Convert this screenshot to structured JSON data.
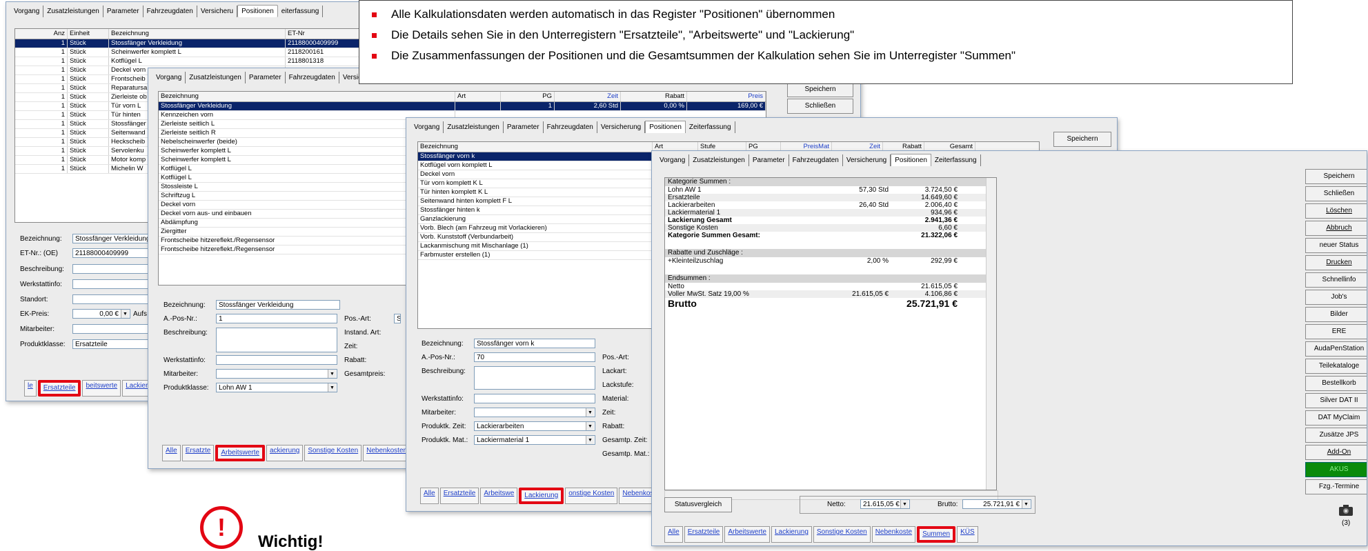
{
  "info_box": {
    "bullets": [
      "Alle Kalkulationsdaten werden automatisch in das Register \"Positionen\" übernommen",
      "Die Details sehen Sie in den Unterregistern \"Ersatzteile\", \"Arbeitswerte\" und \"Lackierung\"",
      "Die Zusammenfassungen der Positionen und die Gesamtsummen der Kalkulation sehen Sie im Unterregister \"Summen\""
    ],
    "accent_color": "#e30613"
  },
  "warning": {
    "icon": "!",
    "label": "Wichtig!"
  },
  "window1": {
    "tabs": [
      "Vorgang",
      "Zusatzleistungen",
      "Parameter",
      "Fahrzeugdaten",
      "Versicheru",
      "Positionen",
      "eiterfassung"
    ],
    "columns": [
      "Anz",
      "Einheit",
      "Bezeichnung",
      "ET-Nr"
    ],
    "rows": [
      {
        "anz": "1",
        "einheit": "Stück",
        "bez": "Stossfänger Verkleidung",
        "et": "21188000409999"
      },
      {
        "anz": "1",
        "einheit": "Stück",
        "bez": "Scheinwerfer komplett L",
        "et": "2118200161"
      },
      {
        "anz": "1",
        "einheit": "Stück",
        "bez": "Kotflügel L",
        "et": "2118801318"
      },
      {
        "anz": "1",
        "einheit": "Stück",
        "bez": "Deckel vorn",
        "et": ""
      },
      {
        "anz": "1",
        "einheit": "Stück",
        "bez": "Frontscheib",
        "et": ""
      },
      {
        "anz": "1",
        "einheit": "Stück",
        "bez": "Reparatursa",
        "et": ""
      },
      {
        "anz": "1",
        "einheit": "Stück",
        "bez": "Zierleiste ob",
        "et": ""
      },
      {
        "anz": "1",
        "einheit": "Stück",
        "bez": "Tür vorn L",
        "et": ""
      },
      {
        "anz": "1",
        "einheit": "Stück",
        "bez": "Tür hinten",
        "et": ""
      },
      {
        "anz": "1",
        "einheit": "Stück",
        "bez": "Stossfänger",
        "et": ""
      },
      {
        "anz": "1",
        "einheit": "Stück",
        "bez": "Seitenwand",
        "et": ""
      },
      {
        "anz": "1",
        "einheit": "Stück",
        "bez": "Heckscheib",
        "et": ""
      },
      {
        "anz": "1",
        "einheit": "Stück",
        "bez": "Servolenku",
        "et": ""
      },
      {
        "anz": "1",
        "einheit": "Stück",
        "bez": "Motor komp",
        "et": ""
      },
      {
        "anz": "1",
        "einheit": "Stück",
        "bez": "Michelin W",
        "et": ""
      }
    ],
    "form": {
      "bezeichnung_label": "Bezeichnung:",
      "bezeichnung": "Stossfänger Verkleidung",
      "etnr_label": "ET-Nr.: (OE)",
      "etnr": "21188000409999",
      "beschreibung_label": "Beschreibung:",
      "werkstattinfo_label": "Werkstattinfo:",
      "standort_label": "Standort:",
      "ekpreis_label": "EK-Preis:",
      "ekpreis": "0,00 €",
      "aufs": "Aufs",
      "mitarbeiter_label": "Mitarbeiter:",
      "produktklasse_label": "Produktklasse:",
      "produktklasse": "Ersatzteile"
    },
    "bottom_tabs": [
      "le",
      "Ersatzteile",
      "beitswerte",
      "Lackieru"
    ]
  },
  "window2": {
    "tabs": [
      "Vorgang",
      "Zusatzleistungen",
      "Parameter",
      "Fahrzeugdaten",
      "Versic"
    ],
    "columns": [
      "Bezeichnung",
      "Art",
      "PG",
      "Zeit",
      "Rabatt",
      "Preis"
    ],
    "selected_row": {
      "bez": "Stossfänger Verkleidung",
      "pg": "1",
      "zeit": "2,60 Std",
      "rabatt": "0,00 %",
      "preis": "169,00 €"
    },
    "rows": [
      "Kennzeichen vorn",
      "Zierleiste seitlich L",
      "Zierleiste seitlich R",
      "Nebelscheinwerfer (beide)",
      "Scheinwerfer komplett L",
      "Scheinwerfer komplett L",
      "Kotflügel L",
      "Kotflügel L",
      "Stossleiste L",
      "Schriftzug L",
      "Deckel vorn",
      "Deckel vorn aus- und einbauen",
      "Abdämpfung",
      "Ziergitter",
      "Frontscheibe hitzereflekt./Regensensor",
      "Frontscheibe hitzereflekt./Regensensor"
    ],
    "form": {
      "bezeichnung_label": "Bezeichnung:",
      "bezeichnung": "Stossfänger Verkleidung",
      "apos_label": "A.-Pos-Nr.:",
      "apos": "1",
      "beschreibung_label": "Beschreibung:",
      "werkstattinfo_label": "Werkstattinfo:",
      "mitarbeiter_label": "Mitarbeiter:",
      "produktklasse_label": "Produktklasse:",
      "produktklasse": "Lohn AW 1",
      "posart_label": "Pos.-Art:",
      "posart": "St",
      "instand_label": "Instand. Art:",
      "zeit_label": "Zeit:",
      "rabatt_label": "Rabatt:",
      "gesamtpreis_label": "Gesamtpreis:"
    },
    "bottom_tabs": [
      "Alle",
      "Ersatzte",
      "Arbeitswerte",
      "ackierung",
      "Sonstige Kosten",
      "Nebenkosten"
    ],
    "buttons": [
      "Speichern",
      "Schließen"
    ]
  },
  "window3": {
    "tabs": [
      "Vorgang",
      "Zusatzleistungen",
      "Parameter",
      "Fahrzeugdaten",
      "Versicherung",
      "Positionen",
      "Zeiterfassung"
    ],
    "columns": [
      "Bezeichnung",
      "Art",
      "Stufe",
      "PG",
      "PreisMat",
      "Zeit",
      "Rabatt",
      "Gesamt"
    ],
    "selected_row": "Stossfänger vorn k",
    "rows": [
      "Kotflügel vorn komplett L",
      "Deckel vorn",
      "Tür vorn komplett K L",
      "Tür hinten komplett K L",
      "Seitenwand hinten komplett F L",
      "Stossfänger hinten k",
      "Ganzlackierung",
      "Vorb. Blech (am Fahrzeug mit Vorlackieren)",
      "Vorb. Kunststoff (Verbundarbeit)",
      "Lackanmischung mit Mischanlage (1)",
      "Farbmuster erstellen (1)"
    ],
    "form": {
      "bezeichnung_label": "Bezeichnung:",
      "bezeichnung": "Stossfänger vorn k",
      "apos_label": "A.-Pos-Nr.:",
      "apos": "70",
      "beschreibung_label": "Beschreibung:",
      "werkstattinfo_label": "Werkstattinfo:",
      "mitarbeiter_label": "Mitarbeiter:",
      "prodzeit_label": "Produktk. Zeit:",
      "prodzeit": "Lackierarbeiten",
      "prodmat_label": "Produktk. Mat.:",
      "prodmat": "Lackiermaterial 1",
      "posart_label": "Pos.-Art:",
      "lackart_label": "Lackart:",
      "lackstufe_label": "Lackstufe:",
      "material_label": "Material:",
      "zeit_label": "Zeit:",
      "rabatt_label": "Rabatt:",
      "gzeit_label": "Gesamtp. Zeit:",
      "gmat_label": "Gesamtp. Mat.:"
    },
    "bottom_tabs": [
      "Alle",
      "Ersatzteile",
      "Arbeitswe",
      "Lackierung",
      "onstige Kosten",
      "Nebenkos"
    ],
    "buttons": [
      "Speichern"
    ]
  },
  "window4": {
    "tabs": [
      "Vorgang",
      "Zusatzleistungen",
      "Parameter",
      "Fahrzeugdaten",
      "Versicherung",
      "Positionen",
      "Zeiterfassung"
    ],
    "kategorie_head": "Kategorie Summen :",
    "kategorie": [
      {
        "name": "Lohn AW 1",
        "mid": "57,30 Std",
        "val": "3.724,50 €",
        "bold": false
      },
      {
        "name": "Ersatzteile",
        "mid": "",
        "val": "14.649,60 €",
        "bold": false
      },
      {
        "name": "Lackierarbeiten",
        "mid": "26,40 Std",
        "val": "2.006,40 €",
        "bold": false
      },
      {
        "name": "Lackiermaterial 1",
        "mid": "",
        "val": "934,96 €",
        "bold": false
      },
      {
        "name": "Lackierung Gesamt",
        "mid": "",
        "val": "2.941,36 €",
        "bold": true
      },
      {
        "name": "Sonstige Kosten",
        "mid": "",
        "val": "6,60 €",
        "bold": false
      },
      {
        "name": "Kategorie Summen Gesamt:",
        "mid": "",
        "val": "21.322,06 €",
        "bold": true
      }
    ],
    "rabatte_head": "Rabatte und Zuschläge :",
    "rabatte": [
      {
        "name": "+Kleinteilzuschlag",
        "mid": "2,00 %",
        "val": "292,99 €"
      }
    ],
    "end_head": "Endsummen :",
    "netto": {
      "name": "Netto",
      "val": "21.615,05 €"
    },
    "mwst": {
      "name": "Voller MwSt. Satz  19,00 %",
      "mid": "21.615,05 €",
      "val": "4.106,86 €"
    },
    "brutto": {
      "name": "Brutto",
      "val": "25.721,91 €"
    },
    "statusvergleich": "Statusvergleich",
    "netto_label": "Netto:",
    "netto_value": "21.615,05 €",
    "brutto_label": "Brutto:",
    "brutto_value": "25.721,91 €",
    "bottom_tabs": [
      "Alle",
      "Ersatzteile",
      "Arbeitswerte",
      "Lackierung",
      "Sonstige Kosten",
      "Nebenkoste",
      "Summen",
      "KÜS"
    ],
    "side_buttons": [
      "Speichern",
      "Schließen",
      "Löschen",
      "Abbruch",
      "neuer Status",
      "Drucken",
      "Schnellinfo",
      "Job's",
      "Bilder",
      "ERE",
      "AudaPenStation",
      "Teilekataloge",
      "Bestellkorb",
      "Silver DAT II",
      "DAT MyClaim",
      "Zusätze JPS",
      "Add-On",
      "AKUS",
      "Fzg.-Termine"
    ],
    "akus_color": "#0a8a0a",
    "badge": "(3)"
  }
}
